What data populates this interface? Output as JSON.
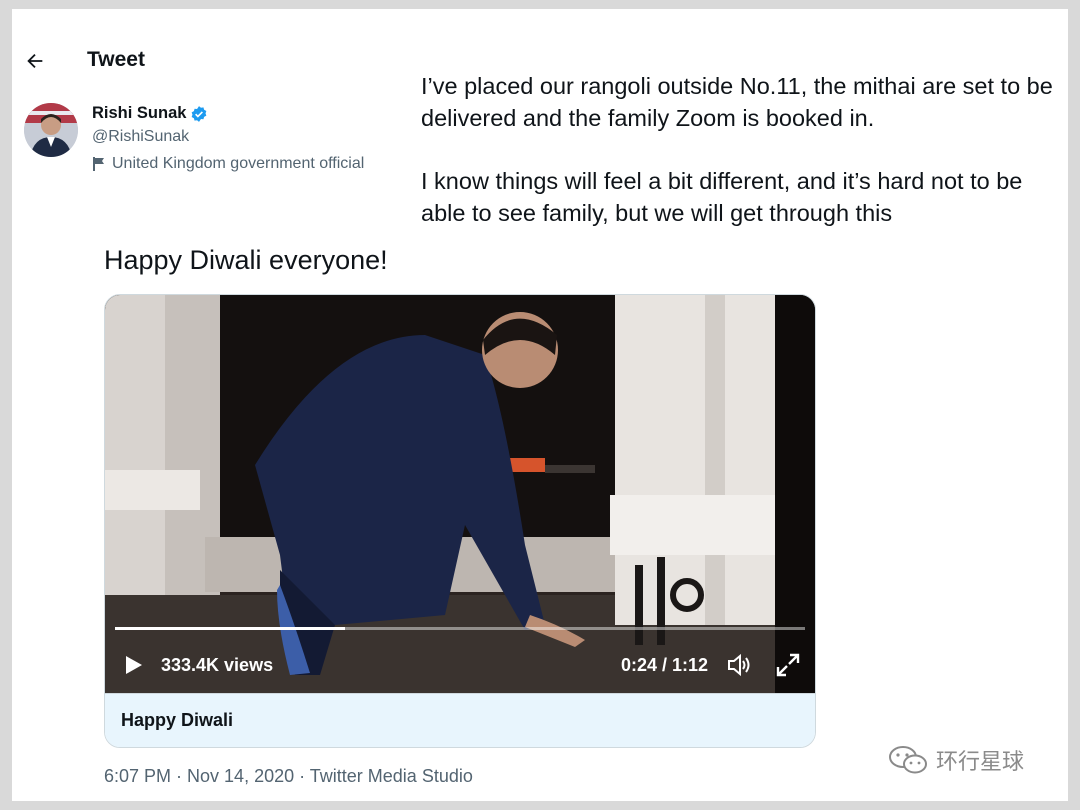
{
  "header": {
    "title": "Tweet"
  },
  "author": {
    "name": "Rishi Sunak",
    "handle": "@RishiSunak",
    "label": "United Kingdom government official"
  },
  "tweet": {
    "text_p1": "I’ve placed our rangoli outside No.11, the mithai are set to be delivered and the family Zoom is booked in.",
    "text_p2": "I know things will feel a bit different, and it’s hard not to be able to see family, but we will get through this",
    "text_p3": "Happy Diwali everyone!"
  },
  "video": {
    "views": "333.4K views",
    "time": "0:24 / 1:12",
    "progress": 0.333,
    "caption": "Happy Diwali"
  },
  "meta": {
    "text": "6:07 PM · Nov 14, 2020 · Twitter Media Studio"
  },
  "watermark": {
    "text": "环行星球"
  },
  "colors": {
    "verified": "#1d9bf0",
    "text": "#0f1419",
    "muted": "#536471",
    "caption_bg": "#e8f5fd"
  },
  "icons": [
    "back-arrow-icon",
    "verified-badge-icon",
    "flag-icon",
    "play-icon",
    "volume-icon",
    "fullscreen-icon",
    "wechat-icon"
  ]
}
